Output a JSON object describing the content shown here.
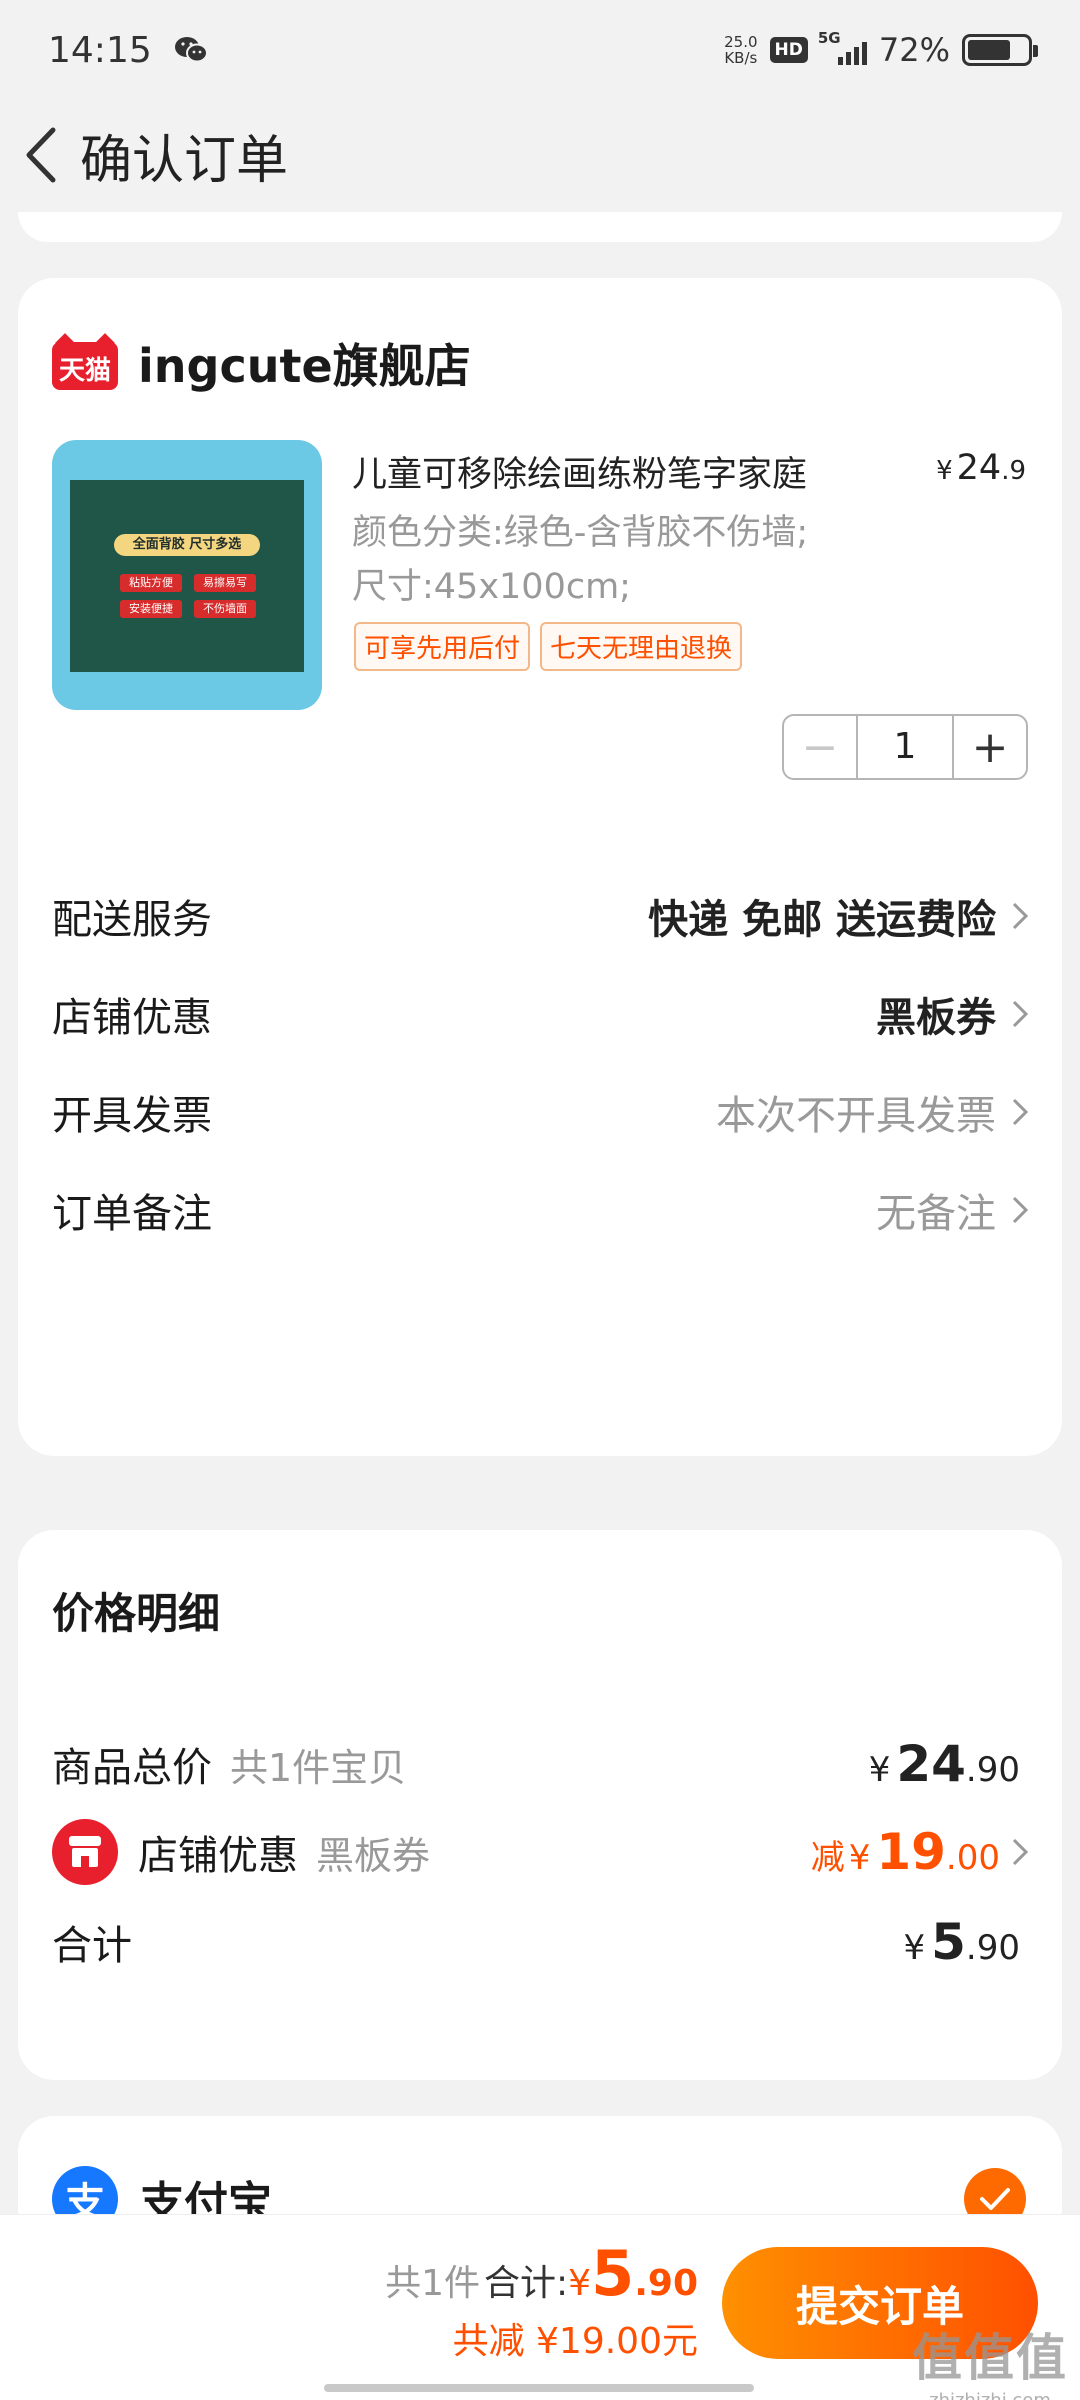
{
  "status_bar": {
    "time": "14:15",
    "net_speed_value": "25.0",
    "net_speed_unit": "KB/s",
    "hd": "HD",
    "network": "5G",
    "battery": "72%",
    "battery_level": 0.72
  },
  "nav": {
    "title": "确认订单"
  },
  "store": {
    "badge": "天猫",
    "name": "ingcute旗舰店"
  },
  "product": {
    "title": "儿童可移除绘画练粉笔字家庭",
    "price_symbol": "¥",
    "price_int": "24",
    "price_dec": ".9",
    "spec_color": "颜色分类:绿色-含背胶不伤墙;",
    "spec_size": "尺寸:45x100cm;",
    "tags": [
      "可享先用后付",
      "七天无理由退换"
    ],
    "quantity": "1",
    "image_text": {
      "headline": "全面背胶 尺寸多选",
      "tag1": "粘贴方便",
      "tag2": "易擦易写",
      "tag3": "安装便捷",
      "tag4": "不伤墙面"
    }
  },
  "options": {
    "delivery": {
      "label": "配送服务",
      "value": "快递 免邮 送运费险"
    },
    "discount": {
      "label": "店铺优惠",
      "value": "黑板券"
    },
    "invoice": {
      "label": "开具发票",
      "value": "本次不开具发票"
    },
    "note": {
      "label": "订单备注",
      "value": "无备注"
    }
  },
  "price_detail": {
    "title": "价格明细",
    "subtotal": {
      "label": "商品总价",
      "sub": "共1件宝贝",
      "yen": "¥",
      "int": "24",
      "dec": ".90"
    },
    "discount": {
      "label": "店铺优惠",
      "sub": "黑板券",
      "prefix": "减",
      "yen": "¥",
      "int": "19",
      "dec": ".00"
    },
    "total": {
      "label": "合计",
      "yen": "¥",
      "int": "5",
      "dec": ".90"
    }
  },
  "payment": {
    "method": "支付宝",
    "selected": true
  },
  "bottom": {
    "count": "共1件",
    "total_label": "合计:",
    "yen": "¥",
    "int": "5",
    "dec": ".90",
    "saved": "共减 ¥19.00元",
    "submit": "提交订单"
  },
  "watermark": {
    "main": "值值值",
    "sub": "zhizhizhi.com"
  },
  "colors": {
    "accent": "#ff5000",
    "tmall_red": "#e8202e",
    "alipay_blue": "#1677ff"
  }
}
